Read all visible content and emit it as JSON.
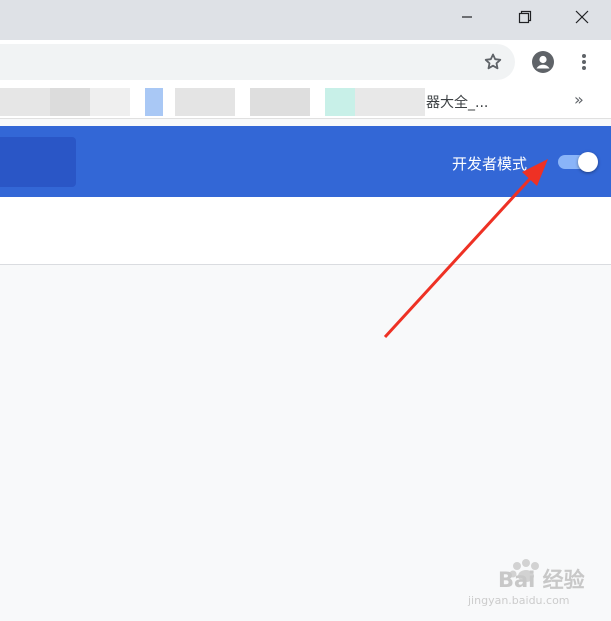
{
  "window_controls": {
    "minimize_icon": "minimize-icon",
    "restore_icon": "restore-icon",
    "close_icon": "close-icon"
  },
  "toolbar": {
    "star_icon": "star-icon",
    "profile_icon": "profile-icon",
    "menu_icon": "kebab-menu-icon"
  },
  "bookmarks": {
    "partial_label": "器大全_...",
    "overflow_label": "»"
  },
  "extensions_header": {
    "developer_mode_label": "开发者模式",
    "developer_mode_on": true,
    "accent_color": "#3367d6"
  },
  "annotation": {
    "arrow_color": "#ee3124"
  },
  "watermark": {
    "brand": "Bai  经验",
    "url": "jingyan.baidu.com"
  }
}
